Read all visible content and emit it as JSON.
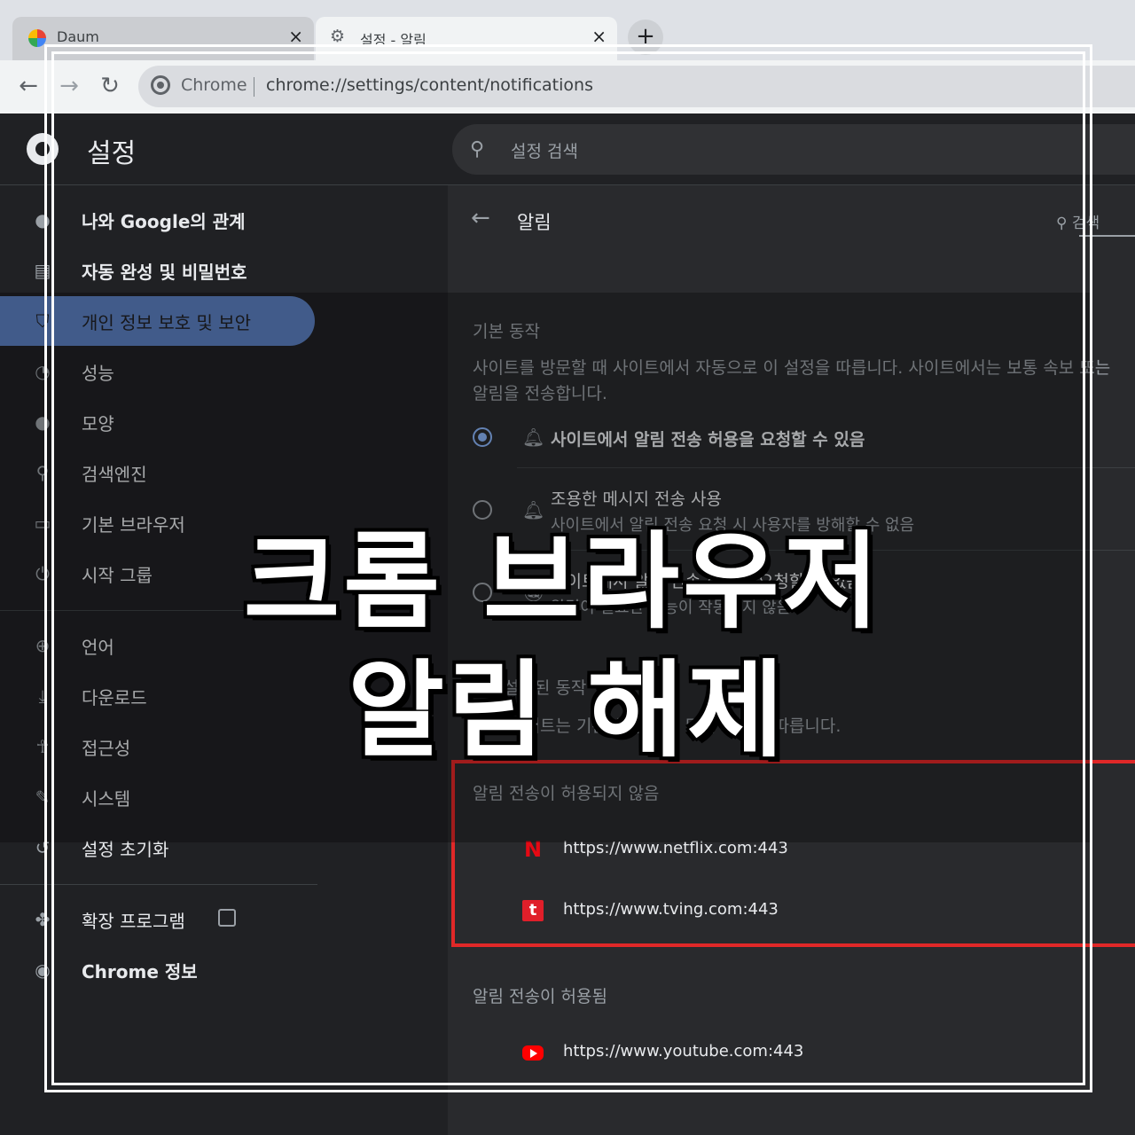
{
  "browser": {
    "tabs": [
      {
        "title": "Daum",
        "close": "×"
      },
      {
        "title": "설정 - 알림",
        "close": "×"
      }
    ],
    "new_tab": "+",
    "omnibox": {
      "chip": "Chrome",
      "url": "chrome://settings/content/notifications"
    },
    "nav": {
      "back": "←",
      "forward": "→",
      "reload": "↻"
    }
  },
  "settings": {
    "title": "설정",
    "search_placeholder": "설정 검색",
    "sidebar": [
      {
        "label": "나와 Google의 관계",
        "icon": "person-icon"
      },
      {
        "label": "자동 완성 및 비밀번호",
        "icon": "autofill-icon"
      },
      {
        "label": "개인 정보 보호 및 보안",
        "icon": "shield-icon",
        "active": true
      },
      {
        "label": "성능",
        "icon": "speedometer-icon"
      },
      {
        "label": "모양",
        "icon": "palette-icon"
      },
      {
        "label": "검색엔진",
        "icon": "search-icon"
      },
      {
        "label": "기본 브라우저",
        "icon": "browser-icon"
      },
      {
        "label": "시작 그룹",
        "icon": "power-icon"
      },
      {
        "label": "언어",
        "icon": "globe-icon"
      },
      {
        "label": "다운로드",
        "icon": "download-icon"
      },
      {
        "label": "접근성",
        "icon": "accessibility-icon"
      },
      {
        "label": "시스템",
        "icon": "wrench-icon"
      },
      {
        "label": "설정 초기화",
        "icon": "reset-icon"
      },
      {
        "label": "확장 프로그램",
        "icon": "puzzle-icon"
      },
      {
        "label": "Chrome 정보",
        "icon": "chrome-icon"
      }
    ],
    "page": {
      "title": "알림",
      "search": "검색",
      "default_heading": "기본 동작",
      "default_desc": "사이트를 방문할 때 사이트에서 자동으로 이 설정을 따릅니다. 사이트에서는 보통 속보 또는 알림을 전송합니다.",
      "options": [
        {
          "label": "사이트에서 알림 전송 허용을 요청할 수 있음",
          "selected": true
        },
        {
          "label": "조용한 메시지 전송 사용",
          "sub": "사이트에서 알림 전송 요청 시 사용자를 방해할 수 없음"
        },
        {
          "label": "사이트에서 알림 전송 허용을 요청할 수 없음",
          "sub": "알림이 필요한 기능이 작동하지 않음"
        }
      ],
      "custom_heading": "맞춤설정된 동작",
      "custom_desc": "아래 사이트는 기본 설정 대신 맞춤 설정을 따릅니다.",
      "blocked_heading": "알림 전송이 허용되지 않음",
      "blocked_sites": [
        {
          "url": "https://www.netflix.com:443",
          "icon": "N"
        },
        {
          "url": "https://www.tving.com:443",
          "icon": "t"
        }
      ],
      "allowed_heading": "알림 전송이 허용됨",
      "allowed_sites": [
        {
          "url": "https://www.youtube.com:443"
        }
      ]
    }
  },
  "overlay": {
    "line1": "크롬 브라우저",
    "line2": "알림 해제"
  },
  "colors": {
    "accent": "#8ab4f8",
    "active_nav": "#5b7fbf",
    "highlight_box": "#e02828"
  }
}
